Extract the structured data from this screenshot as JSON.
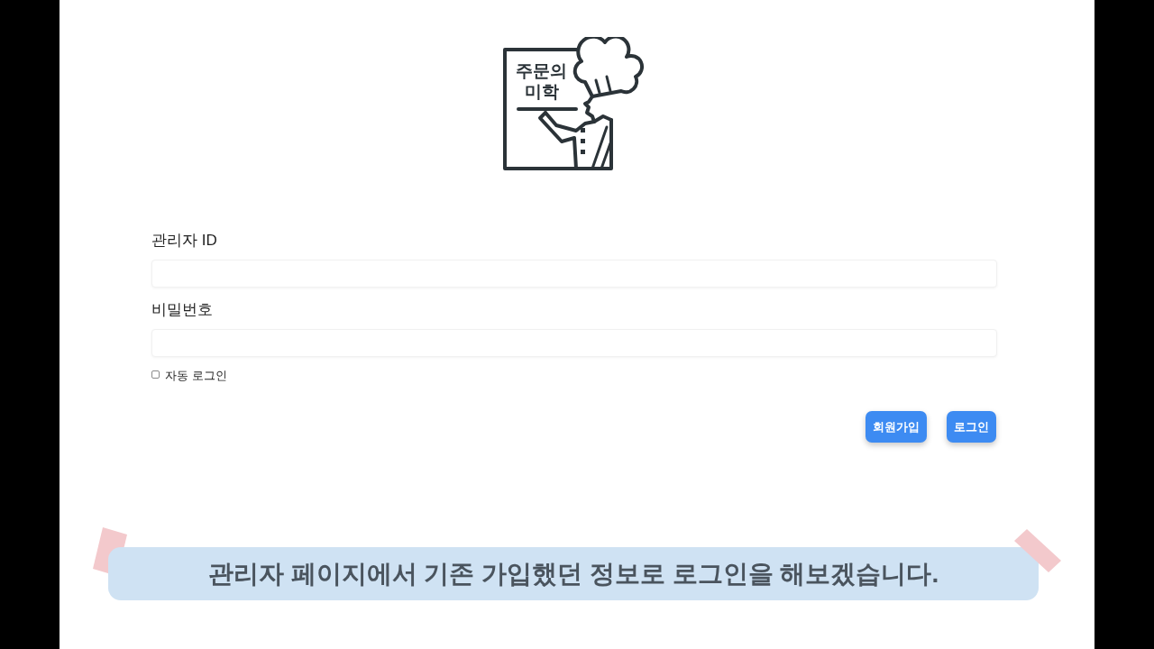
{
  "logo": {
    "lines": [
      "주문의",
      "미학"
    ]
  },
  "form": {
    "fields": [
      {
        "label": "관리자 ID"
      },
      {
        "label": "비밀번호"
      }
    ],
    "auto_login": {
      "label": "자동 로그인",
      "checked": false
    },
    "buttons": [
      {
        "label": "회원가입"
      },
      {
        "label": "로그인"
      }
    ]
  },
  "caption": {
    "text": "관리자 페이지에서 기존 가입했던 정보로 로그인을 해보겠습니다."
  }
}
